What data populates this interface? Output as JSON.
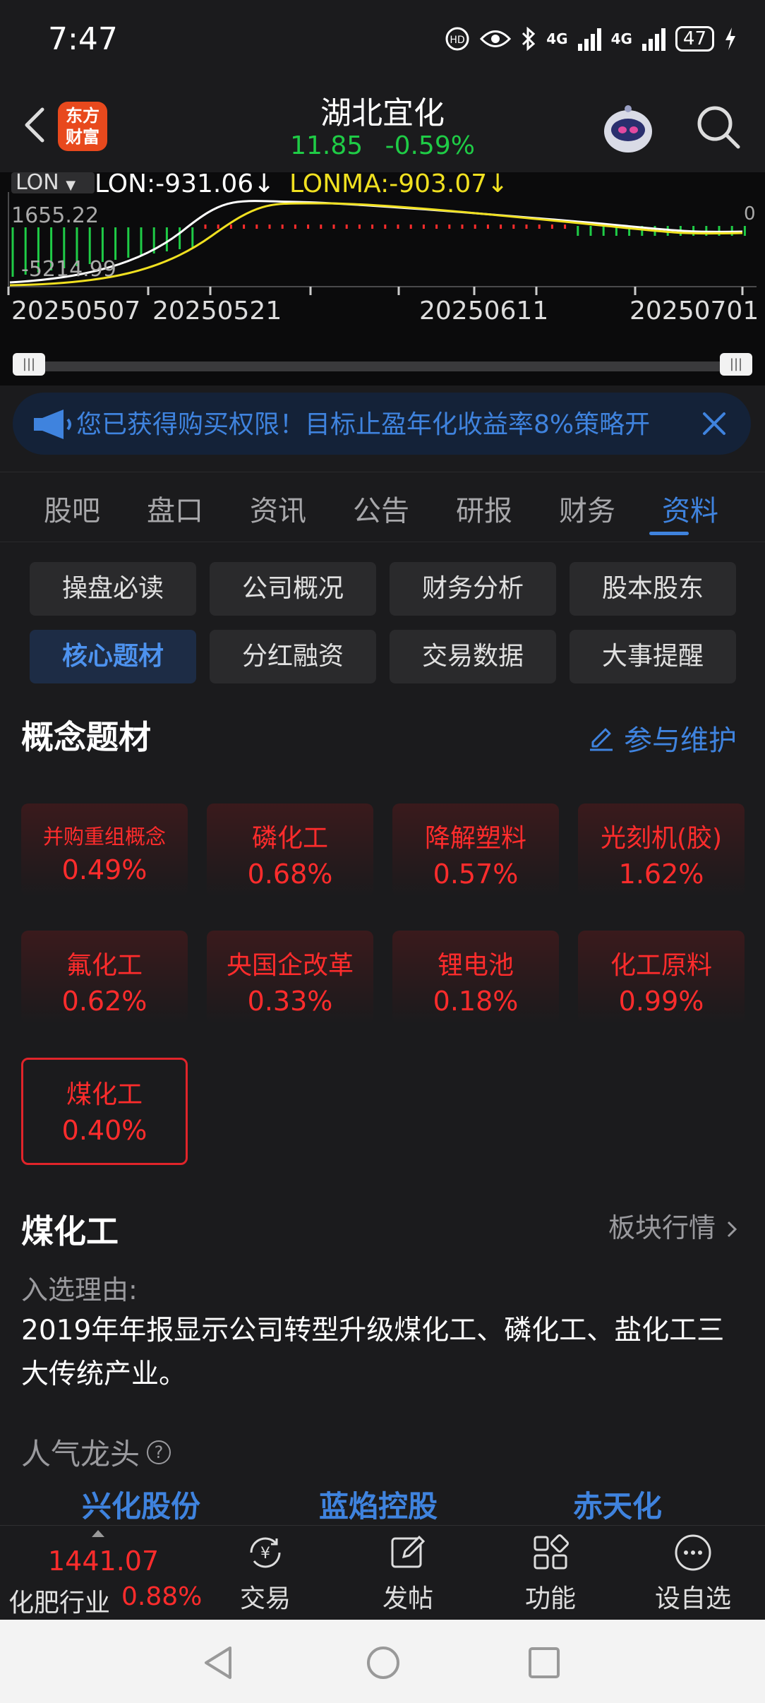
{
  "status_bar": {
    "time": "7:47",
    "battery": "47",
    "network1": "4G",
    "network2": "4G"
  },
  "header": {
    "logo_line1": "东方",
    "logo_line2": "财富",
    "title": "湖北宜化",
    "price": "11.85",
    "change": "-0.59%"
  },
  "chart": {
    "indicator_selector": "LON",
    "lon_value": "LON:-931.06↓",
    "lonma_value": "LONMA:-903.07↓",
    "y_top": "1655.22",
    "y_bottom": "-5214.99",
    "y_right": "0",
    "x_labels": [
      "20250507",
      "20250521",
      "20250611",
      "20250701"
    ]
  },
  "chart_data": {
    "type": "line",
    "title": "",
    "series": [
      {
        "name": "LON"
      },
      {
        "name": "LONMA"
      }
    ],
    "x_ticks": [
      "20250507",
      "20250521",
      "20250611",
      "20250701"
    ],
    "ylim": [
      -5214.99,
      1655.22
    ],
    "last": {
      "LON": -931.06,
      "LONMA": -903.07
    }
  },
  "banner": {
    "text": "您已获得购买权限！目标止盈年化收益率8%策略开"
  },
  "tabs": [
    "股吧",
    "盘口",
    "资讯",
    "公告",
    "研报",
    "财务",
    "资料"
  ],
  "active_tab": "资料",
  "sub_buttons": [
    "操盘必读",
    "公司概况",
    "财务分析",
    "股本股东",
    "核心题材",
    "分红融资",
    "交易数据",
    "大事提醒"
  ],
  "active_sub": "核心题材",
  "concepts": {
    "title": "概念题材",
    "maintain_label": "参与维护",
    "items": [
      {
        "name": "并购重组概念",
        "pct": "0.49%"
      },
      {
        "name": "磷化工",
        "pct": "0.68%"
      },
      {
        "name": "降解塑料",
        "pct": "0.57%"
      },
      {
        "name": "光刻机(胶)",
        "pct": "1.62%"
      },
      {
        "name": "氟化工",
        "pct": "0.62%"
      },
      {
        "name": "央国企改革",
        "pct": "0.33%"
      },
      {
        "name": "锂电池",
        "pct": "0.18%"
      },
      {
        "name": "化工原料",
        "pct": "0.99%"
      },
      {
        "name": "煤化工",
        "pct": "0.40%"
      }
    ]
  },
  "detail": {
    "title": "煤化工",
    "sector_link": "板块行情",
    "reason_label": "入选理由:",
    "reason_text": "2019年年报显示公司转型升级煤化工、磷化工、盐化工三大传统产业。",
    "popular_label": "人气龙头",
    "leaders": [
      "兴化股份",
      "蓝焰控股",
      "赤天化"
    ]
  },
  "bottom_bar": {
    "index_value": "1441.07",
    "index_name": "化肥行业",
    "index_pct": "0.88%",
    "items": [
      "交易",
      "发帖",
      "功能",
      "设自选"
    ]
  },
  "colors": {
    "up": "#ff2c2c",
    "down": "#1fcc46",
    "accent": "#3f83de",
    "bg": "#1b1b1d"
  }
}
